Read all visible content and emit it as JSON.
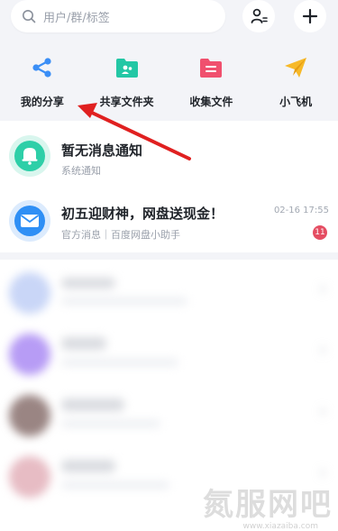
{
  "search": {
    "placeholder": "用户/群/标签"
  },
  "header_buttons": {
    "contacts_icon": "person-list-icon",
    "add_icon": "plus-icon"
  },
  "shortcuts": [
    {
      "label": "我的分享",
      "icon": "share-icon",
      "color": "#3a8ef6"
    },
    {
      "label": "共享文件夹",
      "icon": "shared-folder-icon",
      "color": "#23c7a5"
    },
    {
      "label": "收集文件",
      "icon": "collect-folder-icon",
      "color": "#f0506e"
    },
    {
      "label": "小飞机",
      "icon": "paper-plane-icon",
      "color": "#f7b928"
    }
  ],
  "messages": [
    {
      "title": "暂无消息通知",
      "subtitle": "系统通知",
      "icon": "bell-icon",
      "color": "#2ecfa8"
    },
    {
      "title": "初五迎财神，网盘送现金！",
      "subtitle": "官方消息｜百度网盘小助手",
      "time": "02-16 17:55",
      "badge": "11",
      "icon": "mail-icon",
      "color": "#2f8ff5"
    }
  ],
  "blurred_counts": [
    "3",
    "3",
    "3",
    "3"
  ],
  "watermark": {
    "text": "氮服网吧",
    "url": "www.xiazaiba.com"
  }
}
